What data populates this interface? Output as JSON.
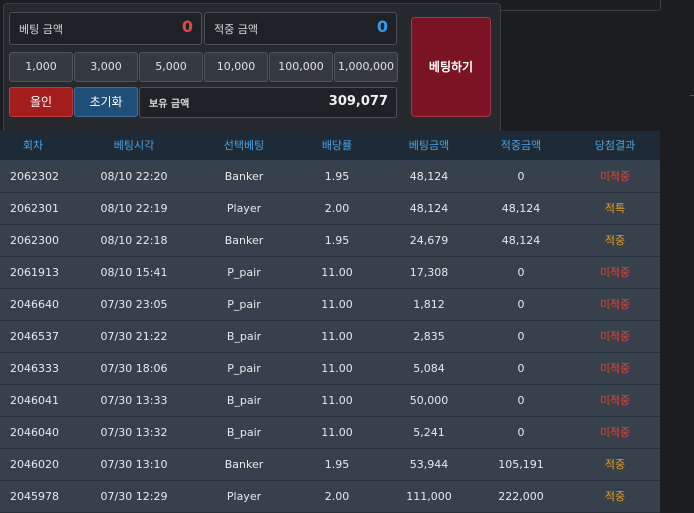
{
  "panel": {
    "bet_amount_label": "베팅 금액",
    "bet_amount_value": "0",
    "win_amount_label": "적중 금액",
    "win_amount_value": "0",
    "chips": [
      "1,000",
      "3,000",
      "5,000",
      "10,000",
      "100,000",
      "1,000,000"
    ],
    "allin_label": "올인",
    "reset_label": "초기화",
    "balance_label": "보유 금액",
    "balance_value": "309,077",
    "bet_button_label": "베팅하기"
  },
  "colors": {
    "bet_value": "#e04848",
    "win_value": "#3a9ae8",
    "header_text": "#4ea0e0",
    "result_lose": "#e0443a",
    "result_win": "#e8a020"
  },
  "table": {
    "headers": [
      "회차",
      "베팅시각",
      "선택베팅",
      "배당률",
      "베팅금액",
      "적중금액",
      "당첨결과"
    ],
    "rows": [
      [
        "2062302",
        "08/10 22:20",
        "Banker",
        "1.95",
        "48,124",
        "0",
        "미적중"
      ],
      [
        "2062301",
        "08/10 22:19",
        "Player",
        "2.00",
        "48,124",
        "48,124",
        "적특"
      ],
      [
        "2062300",
        "08/10 22:18",
        "Banker",
        "1.95",
        "24,679",
        "48,124",
        "적중"
      ],
      [
        "2061913",
        "08/10 15:41",
        "P_pair",
        "11.00",
        "17,308",
        "0",
        "미적중"
      ],
      [
        "2046640",
        "07/30 23:05",
        "P_pair",
        "11.00",
        "1,812",
        "0",
        "미적중"
      ],
      [
        "2046537",
        "07/30 21:22",
        "B_pair",
        "11.00",
        "2,835",
        "0",
        "미적중"
      ],
      [
        "2046333",
        "07/30 18:06",
        "P_pair",
        "11.00",
        "5,084",
        "0",
        "미적중"
      ],
      [
        "2046041",
        "07/30 13:33",
        "B_pair",
        "11.00",
        "50,000",
        "0",
        "미적중"
      ],
      [
        "2046040",
        "07/30 13:32",
        "B_pair",
        "11.00",
        "5,241",
        "0",
        "미적중"
      ],
      [
        "2046020",
        "07/30 13:10",
        "Banker",
        "1.95",
        "53,944",
        "105,191",
        "적중"
      ],
      [
        "2045978",
        "07/30 12:29",
        "Player",
        "2.00",
        "111,000",
        "222,000",
        "적중"
      ]
    ]
  }
}
